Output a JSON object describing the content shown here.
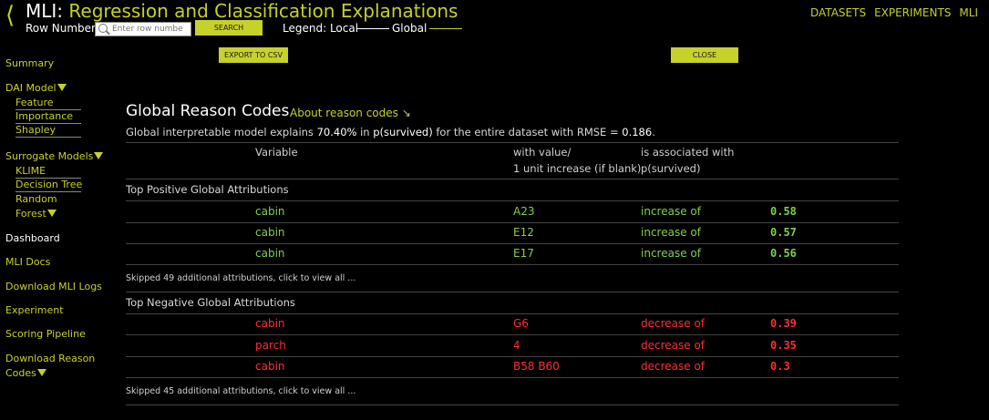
{
  "header": {
    "back_glyph": "⟨",
    "title_prefix": "MLI:",
    "title_rest": " Regression and Classification Explanations",
    "row_number_label": "Row Number:",
    "row_input_placeholder": "Enter row numbe",
    "search_label": "SEARCH",
    "legend_label": "Legend: Local",
    "legend_global": "Global",
    "export_label": "EXPORT TO CSV",
    "close_label": "CLOSE",
    "accent_color": "#c6d12a"
  },
  "topnav": [
    "DATASETS",
    "EXPERIMENTS",
    "MLI"
  ],
  "sidebar": {
    "summary": "Summary",
    "dai_model": "DAI Model",
    "feature": "Feature",
    "importance": "Importance",
    "shapley": "Shapley",
    "surrogate_models": "Surrogate Models",
    "klime": "KLIME",
    "decision_tree": "Decision Tree",
    "random": "Random",
    "forest": "Forest",
    "dashboard": "Dashboard",
    "mli_docs": "MLI Docs",
    "download_logs": "Download MLI Logs",
    "experiment": "Experiment",
    "scoring_pipeline": "Scoring Pipeline",
    "download_reason": "Download Reason",
    "codes": "Codes"
  },
  "main": {
    "title": "Global Reason Codes",
    "about_link": "About reason codes ↘",
    "desc_pre": "Global interpretable model explains ",
    "desc_pct": "70.40%",
    "desc_mid": " in ",
    "desc_target": "p(survived)",
    "desc_post": " for the entire dataset with RMSE = ",
    "desc_rmse": "0.186",
    "desc_end": ".",
    "col_variable": "Variable",
    "col_value_1": "with value/",
    "col_value_2": "1 unit increase (if blank)",
    "col_assoc_1": "is associated with",
    "col_assoc_2": "p(survived)",
    "positive_header": "Top Positive Global Attributions",
    "positive_rows": [
      {
        "variable": "cabin",
        "value": "A23",
        "assoc": "increase of",
        "amount": "0.58"
      },
      {
        "variable": "cabin",
        "value": "E12",
        "assoc": "increase of",
        "amount": "0.57"
      },
      {
        "variable": "cabin",
        "value": "E17",
        "assoc": "increase of",
        "amount": "0.56"
      }
    ],
    "positive_skip": "Skipped 49 additional attributions, click to view all ...",
    "negative_header": "Top Negative Global Attributions",
    "negative_rows": [
      {
        "variable": "cabin",
        "value": "G6",
        "assoc": "decrease of",
        "amount": "0.39"
      },
      {
        "variable": "parch",
        "value": "4",
        "assoc": "decrease of",
        "amount": "0.35"
      },
      {
        "variable": "cabin",
        "value": "B58 B60",
        "assoc": "decrease of",
        "amount": "0.3"
      }
    ],
    "negative_skip": "Skipped 45 additional attributions, click to view all ...",
    "positive_color": "#7fd04a",
    "negative_color": "#ff2d2d"
  }
}
